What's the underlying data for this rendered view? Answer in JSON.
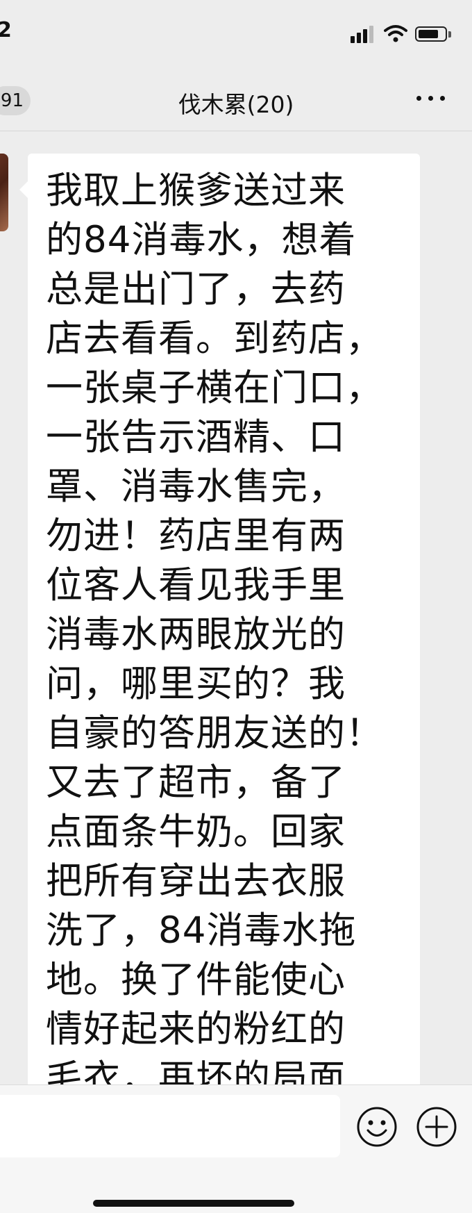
{
  "status_bar": {
    "time": "2"
  },
  "nav": {
    "back_badge": "91",
    "title": "伐木累(20)"
  },
  "message": {
    "text": "我取上猴爹送过来\n的84消毒水，想着\n总是出门了，去药\n店去看看。到药店，\n一张桌子横在门口，\n一张告示酒精、口\n罩、消毒水售完，\n勿进！药店里有两\n位客人看见我手里\n消毒水两眼放光的\n问，哪里买的？我\n自豪的答朋友送的！\n又去了超市，备了\n点面条牛奶。回家\n把所有穿出去衣服\n洗了，84消毒水拖\n地。换了件能使心\n情好起来的粉红的\n毛衣，再坏的局面"
  },
  "icons": {
    "signal": "cellular-signal-icon",
    "wifi": "wifi-icon",
    "battery": "battery-icon",
    "more": "more-icon",
    "emoji": "emoji-icon",
    "plus": "plus-icon"
  }
}
